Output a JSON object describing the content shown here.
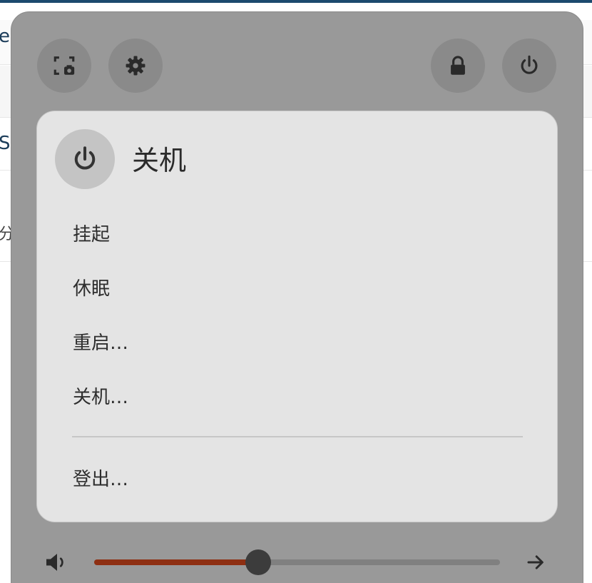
{
  "background": {
    "row1_text": "e",
    "row3_text": "S",
    "row4_text": "分"
  },
  "quick_settings": {
    "screenshot_icon": "screenshot-icon",
    "settings_icon": "gear-icon",
    "lock_icon": "lock-icon",
    "power_icon": "power-icon"
  },
  "power_menu": {
    "title": "关机",
    "items": [
      {
        "label": "挂起"
      },
      {
        "label": "休眠"
      },
      {
        "label": "重启…"
      },
      {
        "label": "关机…"
      }
    ],
    "logout_label": "登出…"
  },
  "volume": {
    "icon": "speaker-icon",
    "level": 0.405,
    "next_icon": "arrow-right-icon"
  },
  "colors": {
    "panel": "#999999",
    "card": "#e4e4e4",
    "slider_fill": "#8e2f12"
  }
}
